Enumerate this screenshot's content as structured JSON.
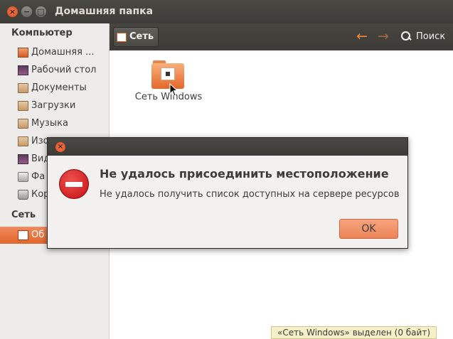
{
  "window": {
    "title": "Домашняя папка",
    "close_glyph": "×",
    "minimize_glyph": "−",
    "maximize_glyph": "□"
  },
  "sidebar": {
    "sections": [
      {
        "heading": "Компьютер"
      },
      {
        "heading": "Сеть"
      }
    ],
    "computer_items": [
      {
        "label": "Домашняя ...",
        "icon": "home-folder-icon"
      },
      {
        "label": "Рабочий стол",
        "icon": "desktop-icon"
      },
      {
        "label": "Документы",
        "icon": "folder-icon"
      },
      {
        "label": "Загрузки",
        "icon": "folder-icon"
      },
      {
        "label": "Музыка",
        "icon": "music-folder-icon"
      },
      {
        "label": "Изо",
        "icon": "folder-icon"
      },
      {
        "label": "Вид",
        "icon": "video-folder-icon"
      },
      {
        "label": "Фа",
        "icon": "drive-icon"
      },
      {
        "label": "Кор",
        "icon": "trash-icon"
      }
    ],
    "network_items": [
      {
        "label": "Об",
        "icon": "network-icon",
        "selected": true
      }
    ]
  },
  "toolbar": {
    "breadcrumb": "Сеть",
    "back_glyph": "←",
    "forward_glyph": "→",
    "search_label": "Поиск"
  },
  "content": {
    "items": [
      {
        "name": "Сеть Windows",
        "icon": "network-folder-icon"
      }
    ],
    "status": "«Сеть Windows» выделен (0 байт)"
  },
  "dialog": {
    "close_glyph": "×",
    "icon": "error-icon",
    "heading": "Не удалось присоединить местоположение",
    "message": "Не удалось получить список доступных на сервере ресурсов",
    "ok_label": "OK"
  },
  "colors": {
    "accent": "#e0662b",
    "titlebar": "#3c3b37",
    "error": "#c41010"
  }
}
